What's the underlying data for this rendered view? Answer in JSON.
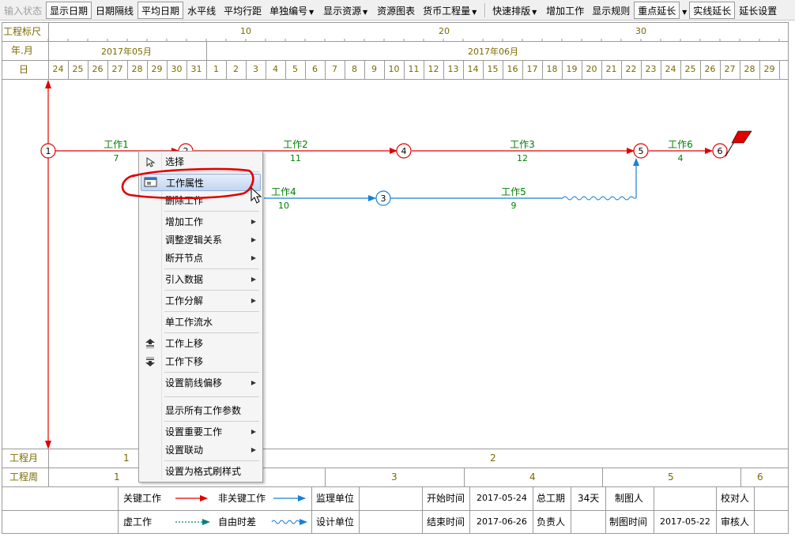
{
  "toolbar": {
    "items": [
      {
        "label": "输入状态",
        "state": "disabled"
      },
      {
        "label": "显示日期",
        "state": "pressed"
      },
      {
        "label": "日期隔线",
        "state": "normal"
      },
      {
        "label": "平均日期",
        "state": "pressed"
      },
      {
        "label": "水平线",
        "state": "normal"
      },
      {
        "label": "平均行距",
        "state": "normal"
      },
      {
        "label": "单独编号",
        "state": "normal",
        "dropdown": true
      },
      {
        "label": "显示资源",
        "state": "normal",
        "dropdown": true
      },
      {
        "label": "资源图表",
        "state": "normal"
      },
      {
        "label": "货币工程量",
        "state": "normal",
        "dropdown": true
      },
      {
        "label": "快速排版",
        "state": "normal",
        "dropdown": true
      },
      {
        "label": "增加工作",
        "state": "normal"
      },
      {
        "label": "显示规则",
        "state": "normal"
      },
      {
        "label": "重点延长",
        "state": "pressed",
        "dropdown": true
      },
      {
        "label": "实线延长",
        "state": "pressed"
      },
      {
        "label": "延长设置",
        "state": "normal"
      }
    ]
  },
  "scale": {
    "ruler_label": "工程标尺",
    "ruler_marks": [
      "10",
      "20",
      "30"
    ],
    "month_row_label": "年.月",
    "months": [
      "2017年05月",
      "2017年06月"
    ],
    "day_row_label": "日",
    "days": [
      "24",
      "25",
      "26",
      "27",
      "28",
      "29",
      "30",
      "31",
      "1",
      "2",
      "3",
      "4",
      "5",
      "6",
      "7",
      "8",
      "9",
      "10",
      "11",
      "12",
      "13",
      "14",
      "15",
      "16",
      "17",
      "18",
      "19",
      "20",
      "21",
      "22",
      "23",
      "24",
      "25",
      "26",
      "27",
      "28",
      "29"
    ]
  },
  "network": {
    "nodes": [
      "1",
      "2",
      "4",
      "5",
      "6",
      "3"
    ],
    "works": [
      {
        "name": "工作1",
        "duration": "7"
      },
      {
        "name": "工作2",
        "duration": "11"
      },
      {
        "name": "工作3",
        "duration": "12"
      },
      {
        "name": "工作6",
        "duration": "4"
      },
      {
        "name": "工作4",
        "duration": "10"
      },
      {
        "name": "工作5",
        "duration": "9"
      }
    ]
  },
  "context_menu": {
    "items": [
      {
        "label": "选择",
        "icon": "select-icon"
      },
      {
        "label": "工作属性",
        "icon": "properties-icon",
        "highlighted": true
      },
      {
        "label": "删除工作"
      },
      {
        "label": "增加工作",
        "submenu": true
      },
      {
        "label": "调整逻辑关系",
        "submenu": true
      },
      {
        "label": "断开节点",
        "submenu": true
      },
      {
        "label": "引入数据",
        "submenu": true
      },
      {
        "label": "工作分解",
        "submenu": true
      },
      {
        "label": "单工作流水"
      },
      {
        "label": "工作上移",
        "icon": "move-up-icon"
      },
      {
        "label": "工作下移",
        "icon": "move-down-icon"
      },
      {
        "label": "设置箭线偏移",
        "submenu": true
      },
      {
        "label": "显示所有工作参数"
      },
      {
        "label": "设置重要工作",
        "submenu": true
      },
      {
        "label": "设置联动",
        "submenu": true
      },
      {
        "label": "设置为格式刷样式"
      }
    ]
  },
  "bottom_scale": {
    "month_label": "工程月",
    "months": [
      "1",
      "2"
    ],
    "week_label": "工程周",
    "weeks": [
      "1",
      "3",
      "4",
      "5",
      "6"
    ]
  },
  "legend": {
    "critical": "关键工作",
    "noncritical": "非关键工作",
    "dummy": "虚工作",
    "free_float": "自由时差",
    "supervisor_label": "监理单位",
    "design_label": "设计单位",
    "start_label": "开始时间",
    "start_value": "2017-05-24",
    "end_label": "结束时间",
    "end_value": "2017-06-26",
    "total_label": "总工期",
    "total_value": "34天",
    "owner_label": "负责人",
    "drawer_label": "制图人",
    "draw_time_label": "制图时间",
    "draw_time_value": "2017-05-22",
    "checker_label": "校对人",
    "reviewer_label": "审核人"
  },
  "colors": {
    "critical": "#e00000",
    "noncritical": "#1a7fd6",
    "dummy": "#008080",
    "label_green": "#008000",
    "scale_text": "#7a6a00",
    "highlight_ring": "#e00000"
  }
}
